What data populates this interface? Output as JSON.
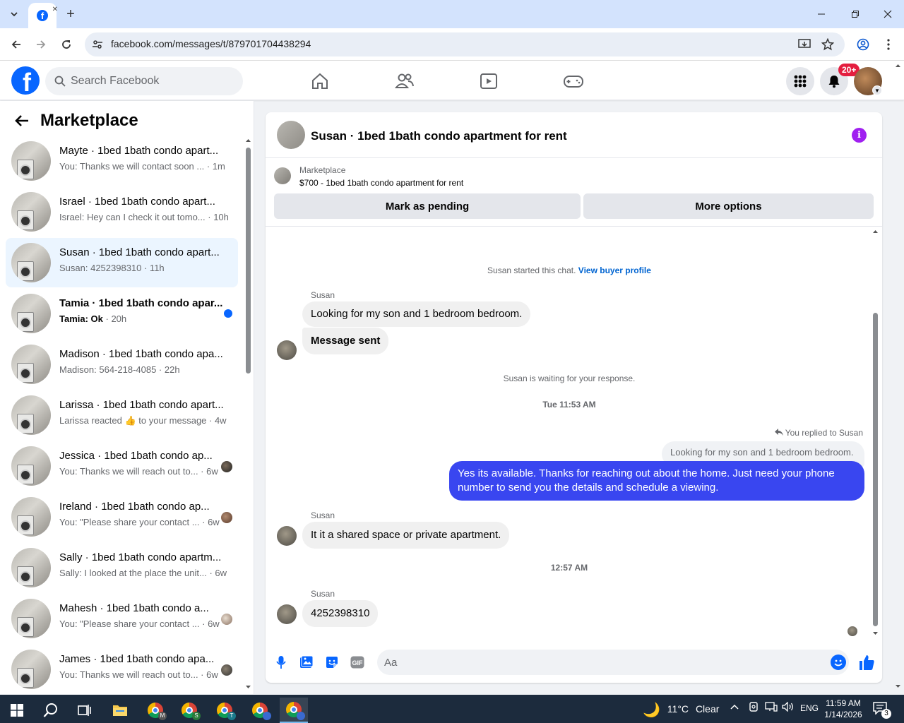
{
  "browser": {
    "url": "facebook.com/messages/t/879701704438294",
    "window_controls": [
      "minimize",
      "restore",
      "close"
    ]
  },
  "header": {
    "search_placeholder": "Search Facebook",
    "notification_badge": "20+"
  },
  "sidebar": {
    "title": "Marketplace",
    "conversations": [
      {
        "name": "Mayte · 1bed 1bath condo apart...",
        "snippet": "You: Thanks we will contact soon ... · 1m"
      },
      {
        "name": "Israel · 1bed 1bath condo apart...",
        "snippet": "Israel: Hey can I check it out tomo... · 10h"
      },
      {
        "name": "Susan · 1bed 1bath condo apart...",
        "snippet": "Susan: 4252398310 · 11h"
      },
      {
        "name": "Tamia · 1bed 1bath condo apar...",
        "snippet_bold": "Tamia: Ok",
        "snippet": " · 20h"
      },
      {
        "name": "Madison · 1bed 1bath condo apa...",
        "snippet": "Madison: 564-218-4085 · 22h"
      },
      {
        "name": "Larissa · 1bed 1bath condo apart...",
        "snippet_pre": "Larissa reacted ",
        "snippet_emoji": "👍",
        "snippet": " to your message · 4w"
      },
      {
        "name": "Jessica · 1bed 1bath condo ap...",
        "snippet": "You: Thanks we will reach out to... · 6w"
      },
      {
        "name": "Ireland · 1bed 1bath condo ap...",
        "snippet": "You: \"Please share your contact ... · 6w"
      },
      {
        "name": "Sally · 1bed 1bath condo apartm...",
        "snippet": "Sally: I looked at the place the unit... · 6w"
      },
      {
        "name": "Mahesh · 1bed 1bath condo a...",
        "snippet": "You: \"Please share your contact ... · 6w"
      },
      {
        "name": "James · 1bed 1bath condo apa...",
        "snippet": "You: Thanks we will reach out to... · 6w"
      }
    ]
  },
  "chat": {
    "title": "Susan · 1bed 1bath condo apartment for rent",
    "listing_source": "Marketplace",
    "listing_title": "$700 - 1bed 1bath condo apartment for rent",
    "mark_pending_label": "Mark as pending",
    "more_options_label": "More options",
    "started_text": "Susan started this chat.",
    "view_profile_label": "View buyer profile",
    "sender_name": "Susan",
    "msg1": "Looking for my son and 1 bedroom bedroom.",
    "msg2": "Message sent",
    "waiting_text": "Susan is waiting for your response.",
    "timestamp1": "Tue 11:53 AM",
    "replied_label": "You replied to Susan",
    "quoted": "Looking for my son and 1 bedroom bedroom.",
    "my_reply": "Yes its available. Thanks for reaching out about the home. Just need your phone number to send you the details and schedule a viewing.",
    "msg3": "It it a shared space or private apartment.",
    "timestamp2": "12:57 AM",
    "msg4": "4252398310",
    "composer_placeholder": "Aa"
  },
  "taskbar": {
    "weather_temp": "11°C",
    "weather_text": "Clear",
    "lang": "ENG",
    "time": "11:59 AM",
    "date": "1/14/2026",
    "notif_count": "3",
    "chrome_profiles": [
      "M",
      "S",
      "T",
      "",
      ""
    ]
  },
  "colors": {
    "facebook_blue": "#0866ff",
    "outgoing_bubble": "#3946f0",
    "unread_dot": "#0866ff",
    "notification_red": "#e41e3f"
  }
}
